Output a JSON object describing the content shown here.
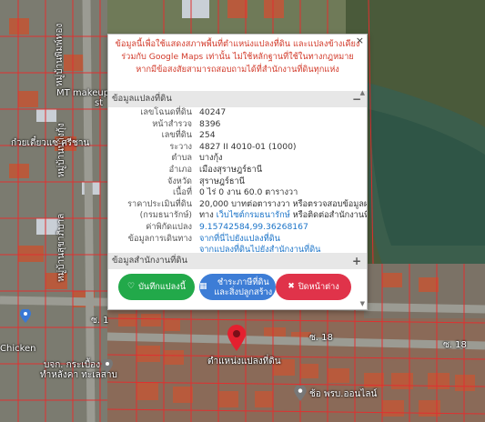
{
  "popup": {
    "close_icon": "×",
    "disclaimer": "ข้อมูลนี้เพื่อใช้แสดงสภาพพื้นที่ตำแหน่งแปลงที่ดิน และแปลงข้างเคียงร่วมกับ Google Maps เท่านั้น ไม่ใช้หลักฐานที่ใช้ในทางกฎหมาย หากมีข้อสงสัยสามารถสอบถามได้ที่สำนักงานที่ดินทุกแห่ง",
    "section1_title": "ข้อมูลแปลงที่ดิน",
    "section1_toggle": "−",
    "section2_title": "ข้อมูลสำนักงานที่ดิน",
    "section2_toggle": "+",
    "rows": [
      {
        "label": "เลขโฉนดที่ดิน",
        "value": "40247"
      },
      {
        "label": "หน้าสำรวจ",
        "value": "8396"
      },
      {
        "label": "เลขที่ดิน",
        "value": "254"
      },
      {
        "label": "ระวาง",
        "value": "4827 II 4010-01 (1000)"
      },
      {
        "label": "ตำบล",
        "value": "บางกุ้ง"
      },
      {
        "label": "อำเภอ",
        "value": "เมืองสุราษฎร์ธานี"
      },
      {
        "label": "จังหวัด",
        "value": "สุราษฎร์ธานี"
      },
      {
        "label": "เนื้อที่",
        "value": "0 ไร่ 0 งาน 60.0 ตารางวา"
      },
      {
        "label": "ราคาประเมินที่ดิน",
        "value": "20,000 บาทต่อตารางวา หรือตรวจสอบข้อมูลผ่าน"
      },
      {
        "label": "(กรมธนารักษ์)",
        "value_pre": "ทาง ",
        "value_link": "เว็บไซต์กรมธนารักษ์",
        "value_post": " หรือติดต่อสำนักงานที่ดิน"
      },
      {
        "label": "ค่าพิกัดแปลง",
        "value_link": "9.15742584,99.36268167"
      },
      {
        "label": "ข้อมูลการเดินทาง",
        "value_link": "จากที่นี่ไปยังแปลงที่ดิน"
      },
      {
        "label": "",
        "value_link": "จากแปลงที่ดินไปยังสำนักงานที่ดิน"
      }
    ],
    "buttons": {
      "save": {
        "icon": "♡",
        "label": "บันทึกแปลงนี้"
      },
      "pay": {
        "icon": "▦",
        "label": "ชำระภาษีที่ดินและสิ่งปลูกสร้าง"
      },
      "close": {
        "icon": "✖",
        "label": "ปิดหน้าต่าง"
      }
    }
  },
  "map": {
    "labels": {
      "makeup": "MT makeup&p",
      "makeup2": "st",
      "road_vertical1": "หมู่บ้านพิมพ์ทอง",
      "road_vertical2": "หมู่บ้านบางกุ้ง",
      "road_vertical3": "หมู่บ้านสุขาภิบาล",
      "shop1": "ก๋วยเตี๋ยวแซ่ ศรีชาน",
      "soi1": "ซ. 18",
      "soi2": "ซ. 18",
      "soi3": "ซ. 1",
      "pin_label": "ตำแหน่งแปลงที่ดิน",
      "bottom_left1": "บจก. กระเบื้อง",
      "bottom_left2": "ทำหลังคา ทะเลสาบ",
      "chicken": "Chicken",
      "bottom_right": "ช้อ พรบ.ออนไลน์"
    }
  }
}
